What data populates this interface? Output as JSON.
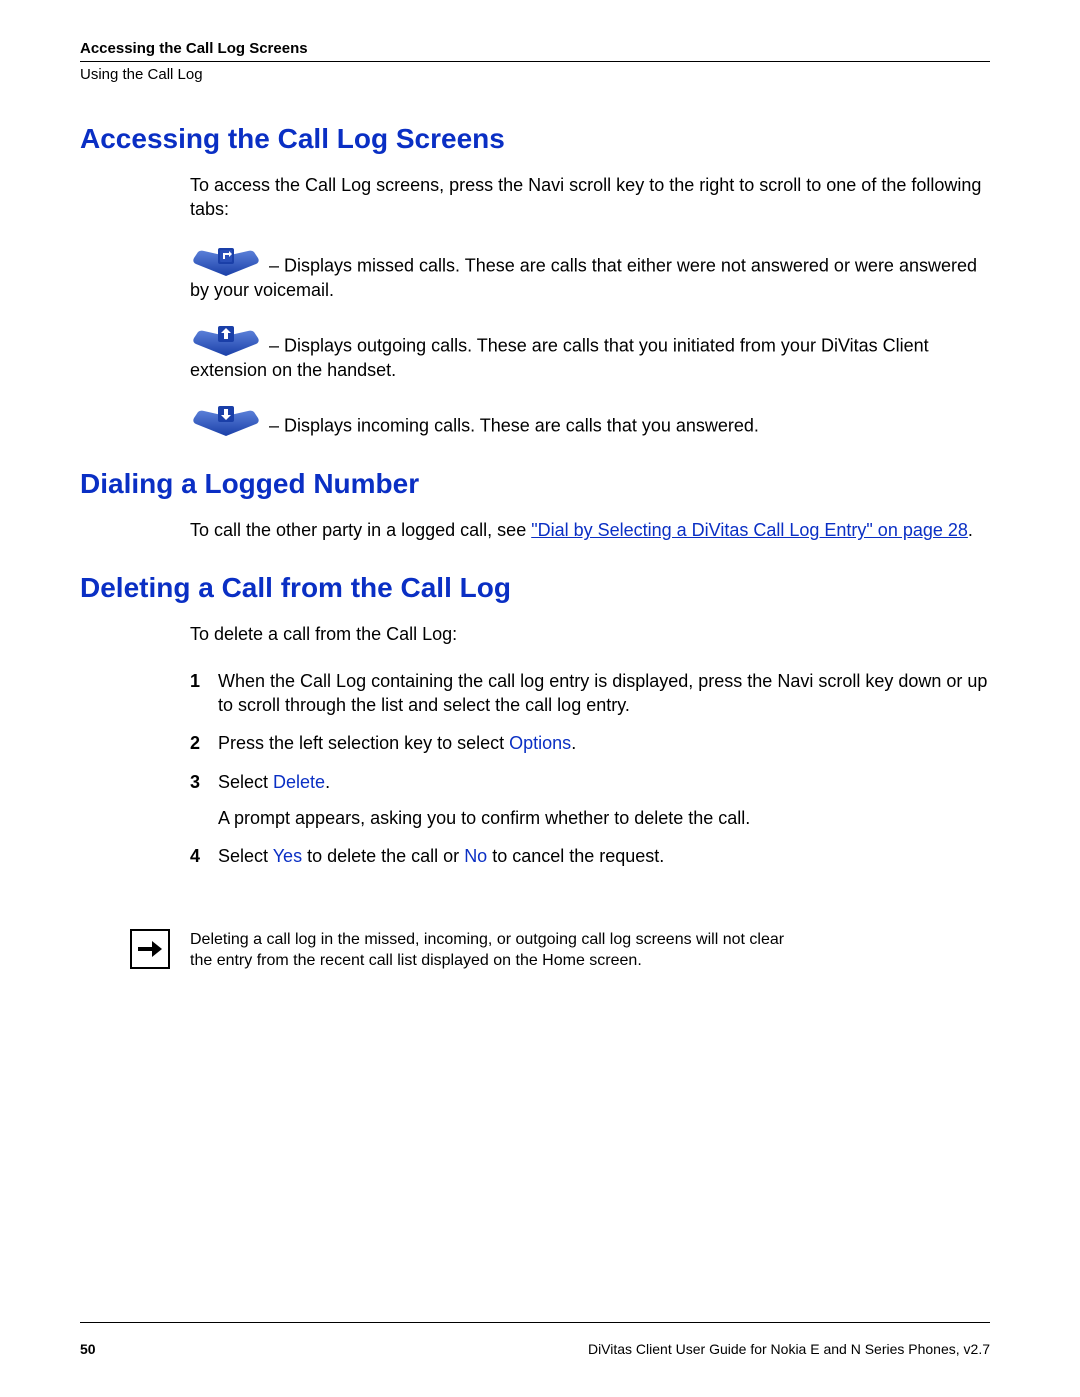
{
  "header": {
    "title": "Accessing the Call Log Screens",
    "subtitle": "Using the Call Log"
  },
  "section1": {
    "heading": "Accessing the Call Log Screens",
    "intro": "To access the Call Log screens, press the Navi scroll key to the right to scroll to one of the following tabs:",
    "tabs": {
      "missed": " – Displays missed calls. These are calls that either were not answered or were answered by your voicemail.",
      "outgoing": " – Displays outgoing calls. These are calls that you initiated from your DiVitas Client extension on the handset.",
      "incoming": " – Displays incoming calls. These are calls that you answered."
    }
  },
  "section2": {
    "heading": "Dialing a Logged Number",
    "text_before_link": "To call the other party in a logged call, see ",
    "link_text": "\"Dial by Selecting a DiVitas Call Log Entry\" on page 28",
    "text_after_link": "."
  },
  "section3": {
    "heading": "Deleting a Call from the Call Log",
    "intro": "To delete a call from the Call Log:",
    "steps": {
      "s1": "When the Call Log containing the call log entry is displayed, press the Navi scroll key down or up to scroll through the list and select the call log entry.",
      "s2_a": "Press the left selection key to select ",
      "s2_b": "Options",
      "s2_c": ".",
      "s3_a": "Select ",
      "s3_b": "Delete",
      "s3_c": ".",
      "s3_sub": "A prompt appears, asking you to confirm whether to delete the call.",
      "s4_a": "Select ",
      "s4_b": "Yes",
      "s4_c": " to delete the call or ",
      "s4_d": "No",
      "s4_e": " to cancel the request."
    },
    "nums": {
      "n1": "1",
      "n2": "2",
      "n3": "3",
      "n4": "4"
    }
  },
  "note": "Deleting a call log in the missed, incoming, or outgoing call log screens will not clear the entry from the recent call list displayed on the Home screen.",
  "footer": {
    "page": "50",
    "doc": "DiVitas Client User Guide for Nokia E and N Series Phones, v2.7"
  }
}
